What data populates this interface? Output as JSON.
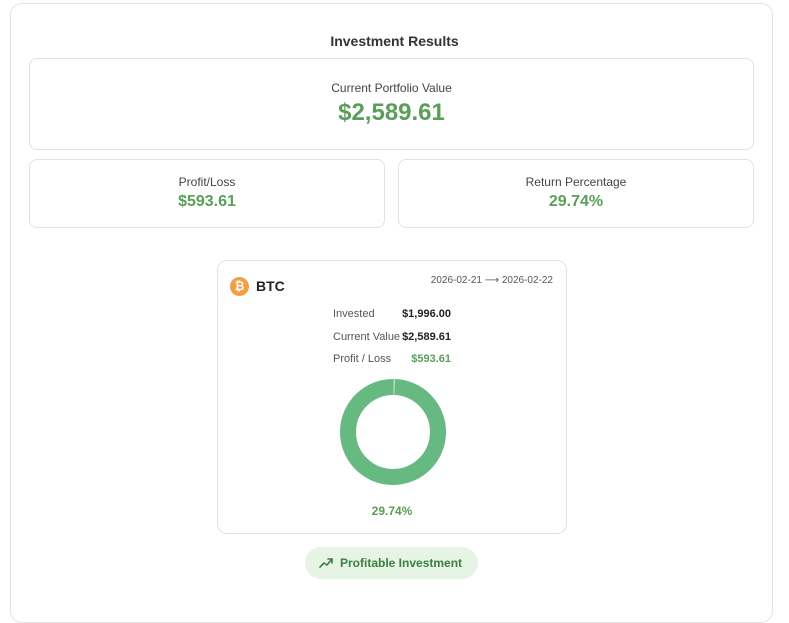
{
  "title": "Investment Results",
  "portfolio": {
    "label": "Current Portfolio Value",
    "value": "$2,589.61"
  },
  "profit_loss": {
    "label": "Profit/Loss",
    "value": "$593.61"
  },
  "return_pct": {
    "label": "Return Percentage",
    "value": "29.74%"
  },
  "coin": {
    "icon": "bitcoin-icon",
    "icon_glyph": "₿",
    "name": "BTC",
    "date_range": "2026-02-21 ⟶ 2026-02-22",
    "invested_label": "Invested",
    "invested_value": "$1,996.00",
    "current_label": "Current Value",
    "current_value": "$2,589.61",
    "pl_label": "Profit / Loss",
    "pl_value": "$593.61",
    "return_pct": "29.74%",
    "donut_fill_fraction": 0.995,
    "donut_color": "#65b981"
  },
  "badge": {
    "icon": "trending-up-icon",
    "label": "Profitable Investment"
  },
  "colors": {
    "positive": "#5a9e5a",
    "bitcoin": "#f0a043"
  }
}
